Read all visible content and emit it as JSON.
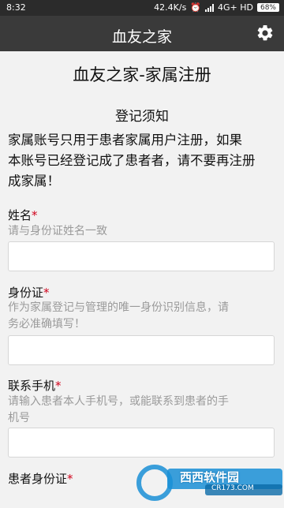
{
  "status_bar": {
    "time": "8:32",
    "speed": "42.4K/s",
    "network": "4G+ HD",
    "battery": "68%"
  },
  "app_bar": {
    "title": "血友之家",
    "settings_icon": "gear-icon"
  },
  "page": {
    "title": "血友之家-家属注册",
    "notice_title": "登记须知",
    "notice_lines": [
      "家属账号只用于患者家属用户注册，如果",
      "本账号已经登记成了患者者，请不要再注册",
      "成家属！"
    ]
  },
  "fields": [
    {
      "label": "姓名",
      "required_mark": "*",
      "hint_lines": [
        "请与身份证姓名一致"
      ],
      "value": ""
    },
    {
      "label": "身份证",
      "required_mark": "*",
      "hint_lines": [
        "作为家属登记与管理的唯一身份识别信息，请",
        "务必准确填写！"
      ],
      "value": ""
    },
    {
      "label": "联系手机",
      "required_mark": "*",
      "hint_lines": [
        "请输入患者本人手机号，或能联系到患者的手",
        "机号"
      ],
      "value": ""
    },
    {
      "label": "患者身份证",
      "required_mark": "*",
      "hint_lines": [],
      "value": ""
    }
  ],
  "watermark": {
    "brand": "西西软件园",
    "url": "CR173.COM"
  },
  "colors": {
    "app_bar": "#3a3a3a",
    "status_bar": "#2b2b2b",
    "background": "#f2f2f2",
    "required": "#d0021b",
    "hint": "#9a9a9a"
  }
}
